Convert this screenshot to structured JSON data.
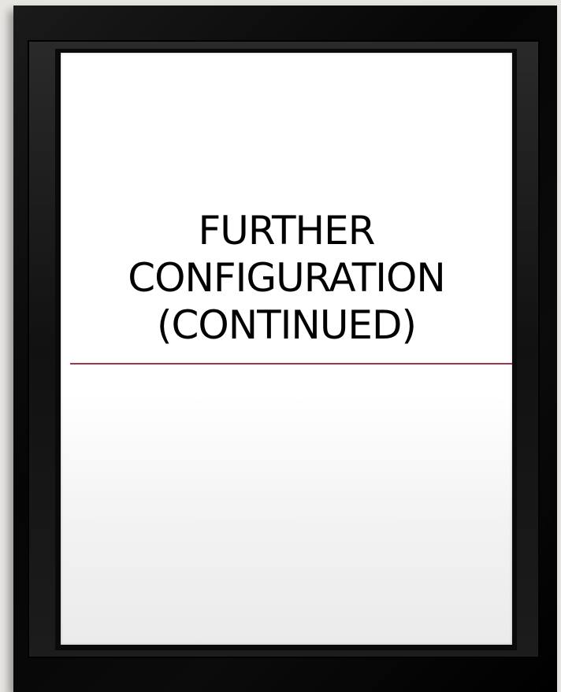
{
  "slide": {
    "title_line_1": "FURTHER",
    "title_line_2": "CONFIGURATION",
    "title_line_3": "(CONTINUED)"
  },
  "colors": {
    "frame": "#000000",
    "canvas": "#ffffff",
    "divider": "#a3344f",
    "title_text": "#000000"
  }
}
